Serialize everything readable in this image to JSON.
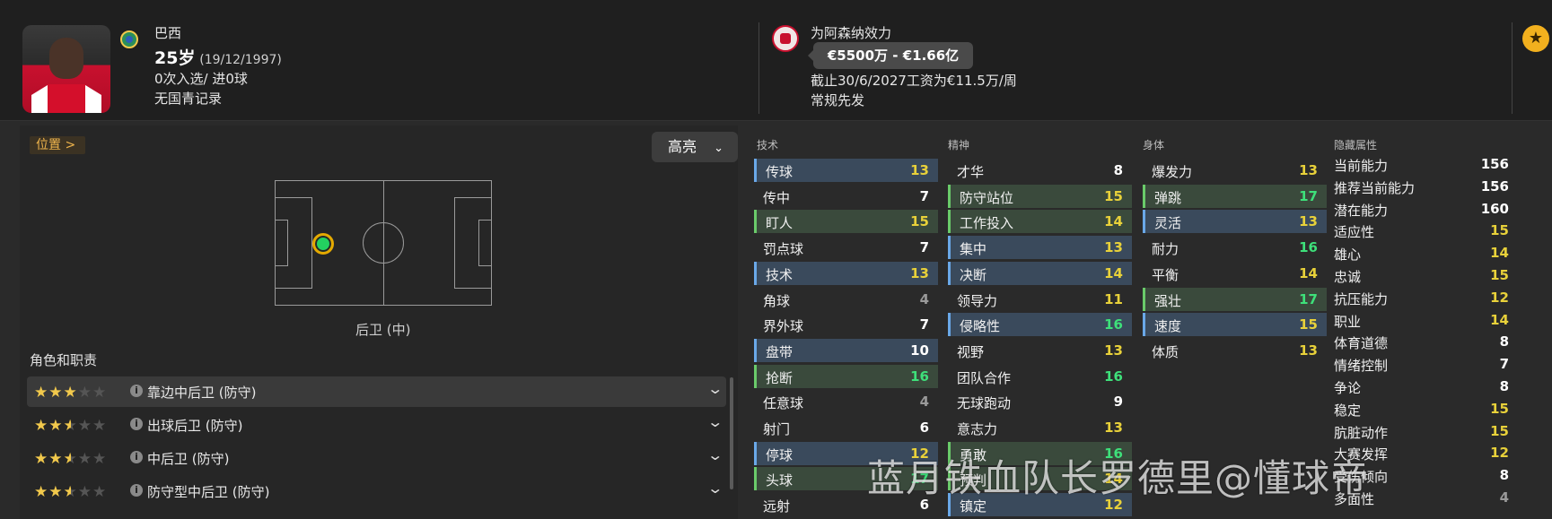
{
  "player": {
    "name": "巴西",
    "age": "25岁",
    "dob": "(19/12/1997)",
    "caps": "0次入选/ 进0球",
    "youth": "无国青记录"
  },
  "contract": {
    "club_line": "为阿森纳效力",
    "value": "€5500万 - €1.66亿",
    "wage_line": "截止30/6/2027工资为€11.5万/周",
    "status": "常规先发"
  },
  "position": {
    "button_label": "位置 >",
    "highlight_label": "高亮",
    "position_label": "后卫 (中)"
  },
  "roles": {
    "title": "角色和职责",
    "items": [
      {
        "name": "靠边中后卫 (防守)",
        "stars": 3
      },
      {
        "name": "出球后卫 (防守)",
        "stars": 2.5
      },
      {
        "name": "中后卫 (防守)",
        "stars": 2.5
      },
      {
        "name": "防守型中后卫 (防守)",
        "stars": 2.5
      }
    ]
  },
  "technical": {
    "title": "技术",
    "items": [
      {
        "name": "传球",
        "value": "13"
      },
      {
        "name": "传中",
        "value": "7"
      },
      {
        "name": "盯人",
        "value": "15"
      },
      {
        "name": "罚点球",
        "value": "7"
      },
      {
        "name": "技术",
        "value": "13"
      },
      {
        "name": "角球",
        "value": "4"
      },
      {
        "name": "界外球",
        "value": "7"
      },
      {
        "name": "盘带",
        "value": "10"
      },
      {
        "name": "抢断",
        "value": "16"
      },
      {
        "name": "任意球",
        "value": "4"
      },
      {
        "name": "射门",
        "value": "6"
      },
      {
        "name": "停球",
        "value": "12"
      },
      {
        "name": "头球",
        "value": "17"
      },
      {
        "name": "远射",
        "value": "6"
      }
    ]
  },
  "mental": {
    "title": "精神",
    "items": [
      {
        "name": "才华",
        "value": "8"
      },
      {
        "name": "防守站位",
        "value": "15"
      },
      {
        "name": "工作投入",
        "value": "14"
      },
      {
        "name": "集中",
        "value": "13"
      },
      {
        "name": "决断",
        "value": "14"
      },
      {
        "name": "领导力",
        "value": "11"
      },
      {
        "name": "侵略性",
        "value": "16"
      },
      {
        "name": "视野",
        "value": "13"
      },
      {
        "name": "团队合作",
        "value": "16"
      },
      {
        "name": "无球跑动",
        "value": "9"
      },
      {
        "name": "意志力",
        "value": "13"
      },
      {
        "name": "勇敢",
        "value": "16"
      },
      {
        "name": "预判",
        "value": "14"
      },
      {
        "name": "镇定",
        "value": "12"
      }
    ]
  },
  "physical": {
    "title": "身体",
    "items": [
      {
        "name": "爆发力",
        "value": "13"
      },
      {
        "name": "弹跳",
        "value": "17"
      },
      {
        "name": "灵活",
        "value": "13"
      },
      {
        "name": "耐力",
        "value": "16"
      },
      {
        "name": "平衡",
        "value": "14"
      },
      {
        "name": "强壮",
        "value": "17"
      },
      {
        "name": "速度",
        "value": "15"
      },
      {
        "name": "体质",
        "value": "13"
      }
    ]
  },
  "hidden": {
    "title": "隐藏属性",
    "items": [
      {
        "name": "当前能力",
        "value": "156"
      },
      {
        "name": "推荐当前能力",
        "value": "156"
      },
      {
        "name": "潜在能力",
        "value": "160"
      },
      {
        "name": "适应性",
        "value": "15"
      },
      {
        "name": "雄心",
        "value": "14"
      },
      {
        "name": "忠诚",
        "value": "15"
      },
      {
        "name": "抗压能力",
        "value": "12"
      },
      {
        "name": "职业",
        "value": "14"
      },
      {
        "name": "体育道德",
        "value": "8"
      },
      {
        "name": "情绪控制",
        "value": "7"
      },
      {
        "name": "争论",
        "value": "8"
      },
      {
        "name": "稳定",
        "value": "15"
      },
      {
        "name": "肮脏动作",
        "value": "15"
      },
      {
        "name": "大赛发挥",
        "value": "12"
      },
      {
        "name": "受伤倾向",
        "value": "8"
      },
      {
        "name": "多面性",
        "value": "4"
      }
    ]
  },
  "watermark": "蓝月铁血队长罗德里@懂球帝",
  "colors": {
    "background": "#2a2a2a",
    "header": "#1f1f1f",
    "accent_orange": "#f0b54c",
    "value_green": "#3ee07a",
    "value_yellow": "#e8d13a"
  }
}
